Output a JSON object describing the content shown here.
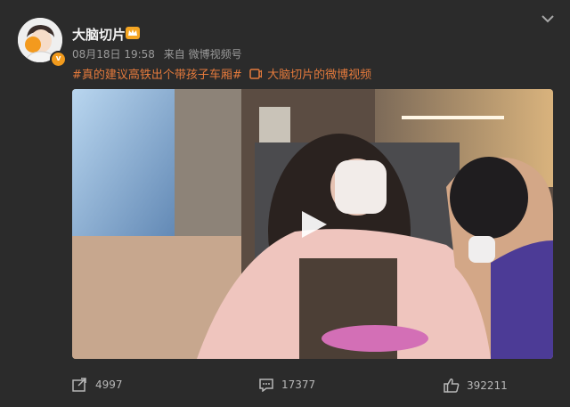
{
  "post": {
    "author": "大脑切片",
    "verified_badge": "v",
    "date": "08月18日 19:58",
    "source": "来自 微博视频号",
    "topic_1": "#真的建议高铁出个带孩子车厢#",
    "link_label": "大脑切片的微博视频",
    "accent_color": "#e47a3c"
  },
  "video": {
    "icons": [
      "play-icon"
    ]
  },
  "actions": {
    "forward_count": "4997",
    "comment_count": "17377",
    "like_count": "392211"
  }
}
